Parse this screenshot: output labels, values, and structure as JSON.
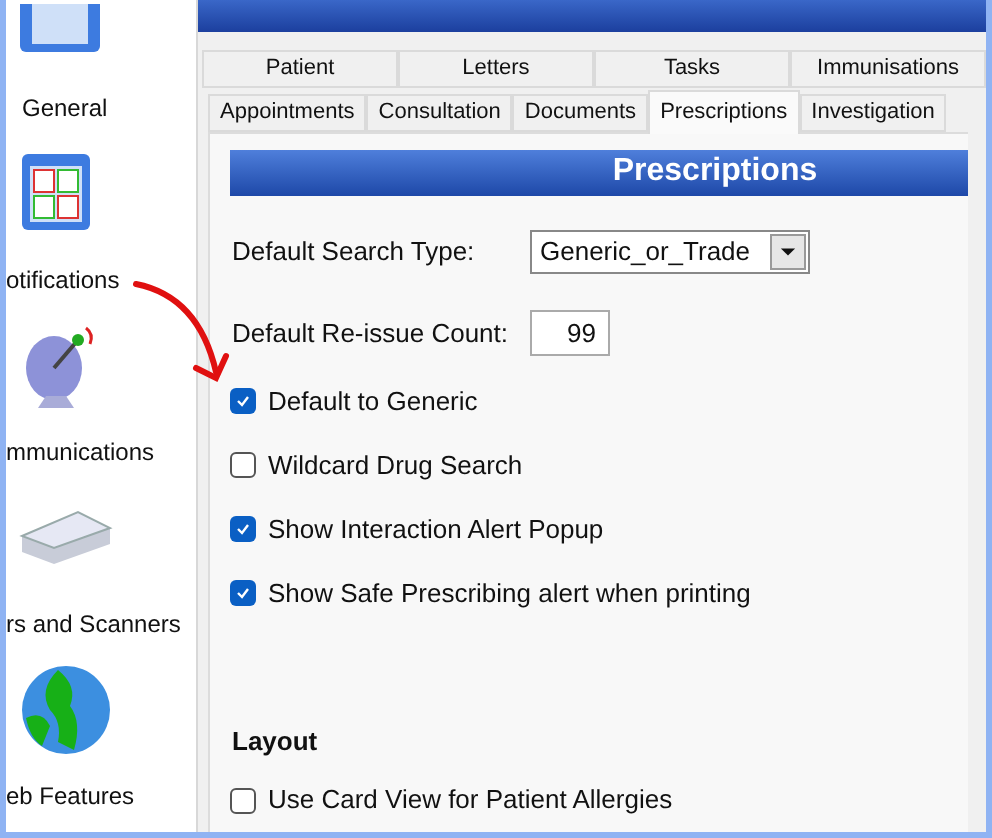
{
  "sidebar": {
    "items": [
      {
        "label": "General"
      },
      {
        "label": "otifications"
      },
      {
        "label": "mmunications"
      },
      {
        "label": "rs and Scanners"
      },
      {
        "label": "eb Features"
      }
    ]
  },
  "tab_rows": [
    [
      {
        "label": "Patient",
        "selected": false
      },
      {
        "label": "Letters",
        "selected": false
      },
      {
        "label": "Tasks",
        "selected": false
      },
      {
        "label": "Immunisations",
        "selected": false
      }
    ],
    [
      {
        "label": "Appointments",
        "selected": false
      },
      {
        "label": "Consultation",
        "selected": false
      },
      {
        "label": "Documents",
        "selected": false
      },
      {
        "label": "Prescriptions",
        "selected": true
      },
      {
        "label": "Investigation",
        "selected": false
      }
    ]
  ],
  "panel": {
    "title": "Prescriptions",
    "search_type": {
      "label": "Default Search Type:",
      "value": "Generic_or_Trade"
    },
    "reissue_count": {
      "label": "Default Re-issue Count:",
      "value": "99"
    },
    "options": [
      {
        "label": "Default to Generic",
        "checked": true
      },
      {
        "label": "Wildcard Drug Search",
        "checked": false
      },
      {
        "label": "Show Interaction Alert Popup",
        "checked": true
      },
      {
        "label": "Show Safe Prescribing alert when printing",
        "checked": true
      }
    ],
    "layout": {
      "heading": "Layout",
      "options": [
        {
          "label": "Use Card View for Patient Allergies",
          "checked": false
        }
      ]
    }
  }
}
